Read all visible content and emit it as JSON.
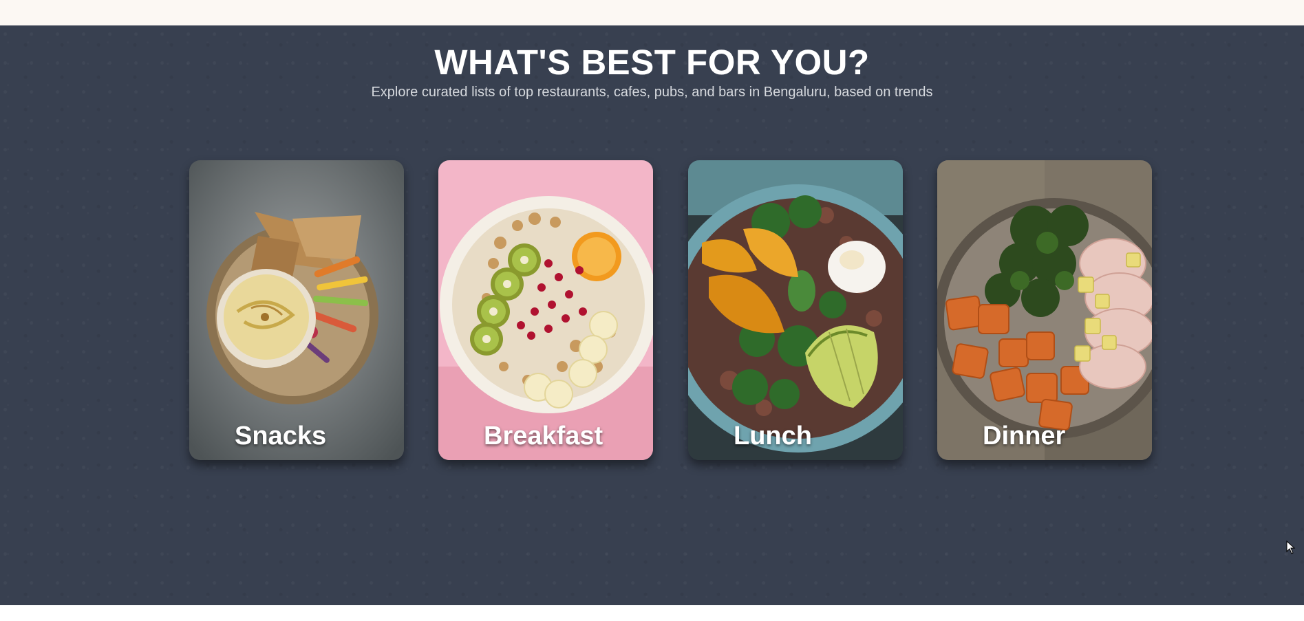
{
  "section": {
    "title": "WHAT'S BEST FOR YOU?",
    "subtitle": "Explore curated lists of top restaurants, cafes, pubs, and bars in Bengaluru, based on trends",
    "background_color": "#384050",
    "top_strip_color": "#fcf8f3"
  },
  "cards": [
    {
      "label": "Snacks",
      "image": "snacks-plate-hummus-toast-vegetables"
    },
    {
      "label": "Breakfast",
      "image": "breakfast-bowl-granola-kiwi-pomegranate-banana"
    },
    {
      "label": "Lunch",
      "image": "lunch-bowl-pumpkin-quinoa-egg-avocado"
    },
    {
      "label": "Dinner",
      "image": "dinner-plate-sweet-potato-kale-pork"
    }
  ]
}
